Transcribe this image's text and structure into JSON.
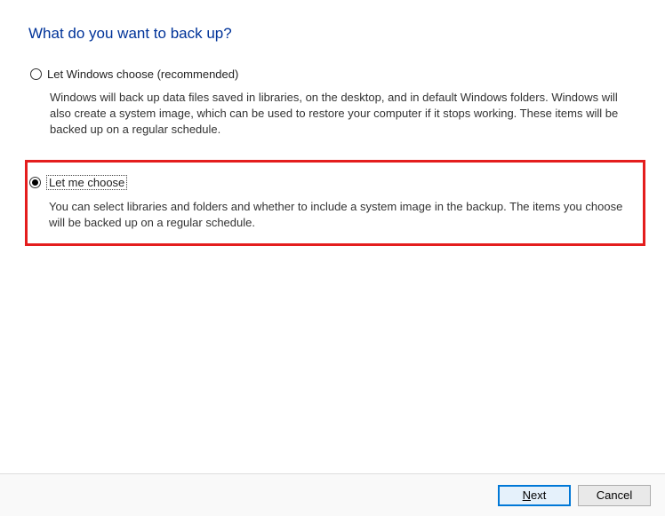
{
  "title": "What do you want to back up?",
  "options": [
    {
      "label": "Let Windows choose (recommended)",
      "description": "Windows will back up data files saved in libraries, on the desktop, and in default Windows folders. Windows will also create a system image, which can be used to restore your computer if it stops working. These items will be backed up on a regular schedule.",
      "selected": false
    },
    {
      "label": "Let me choose",
      "description": "You can select libraries and folders and whether to include a system image in the backup. The items you choose will be backed up on a regular schedule.",
      "selected": true
    }
  ],
  "buttons": {
    "next_prefix": "N",
    "next_rest": "ext",
    "cancel": "Cancel"
  }
}
